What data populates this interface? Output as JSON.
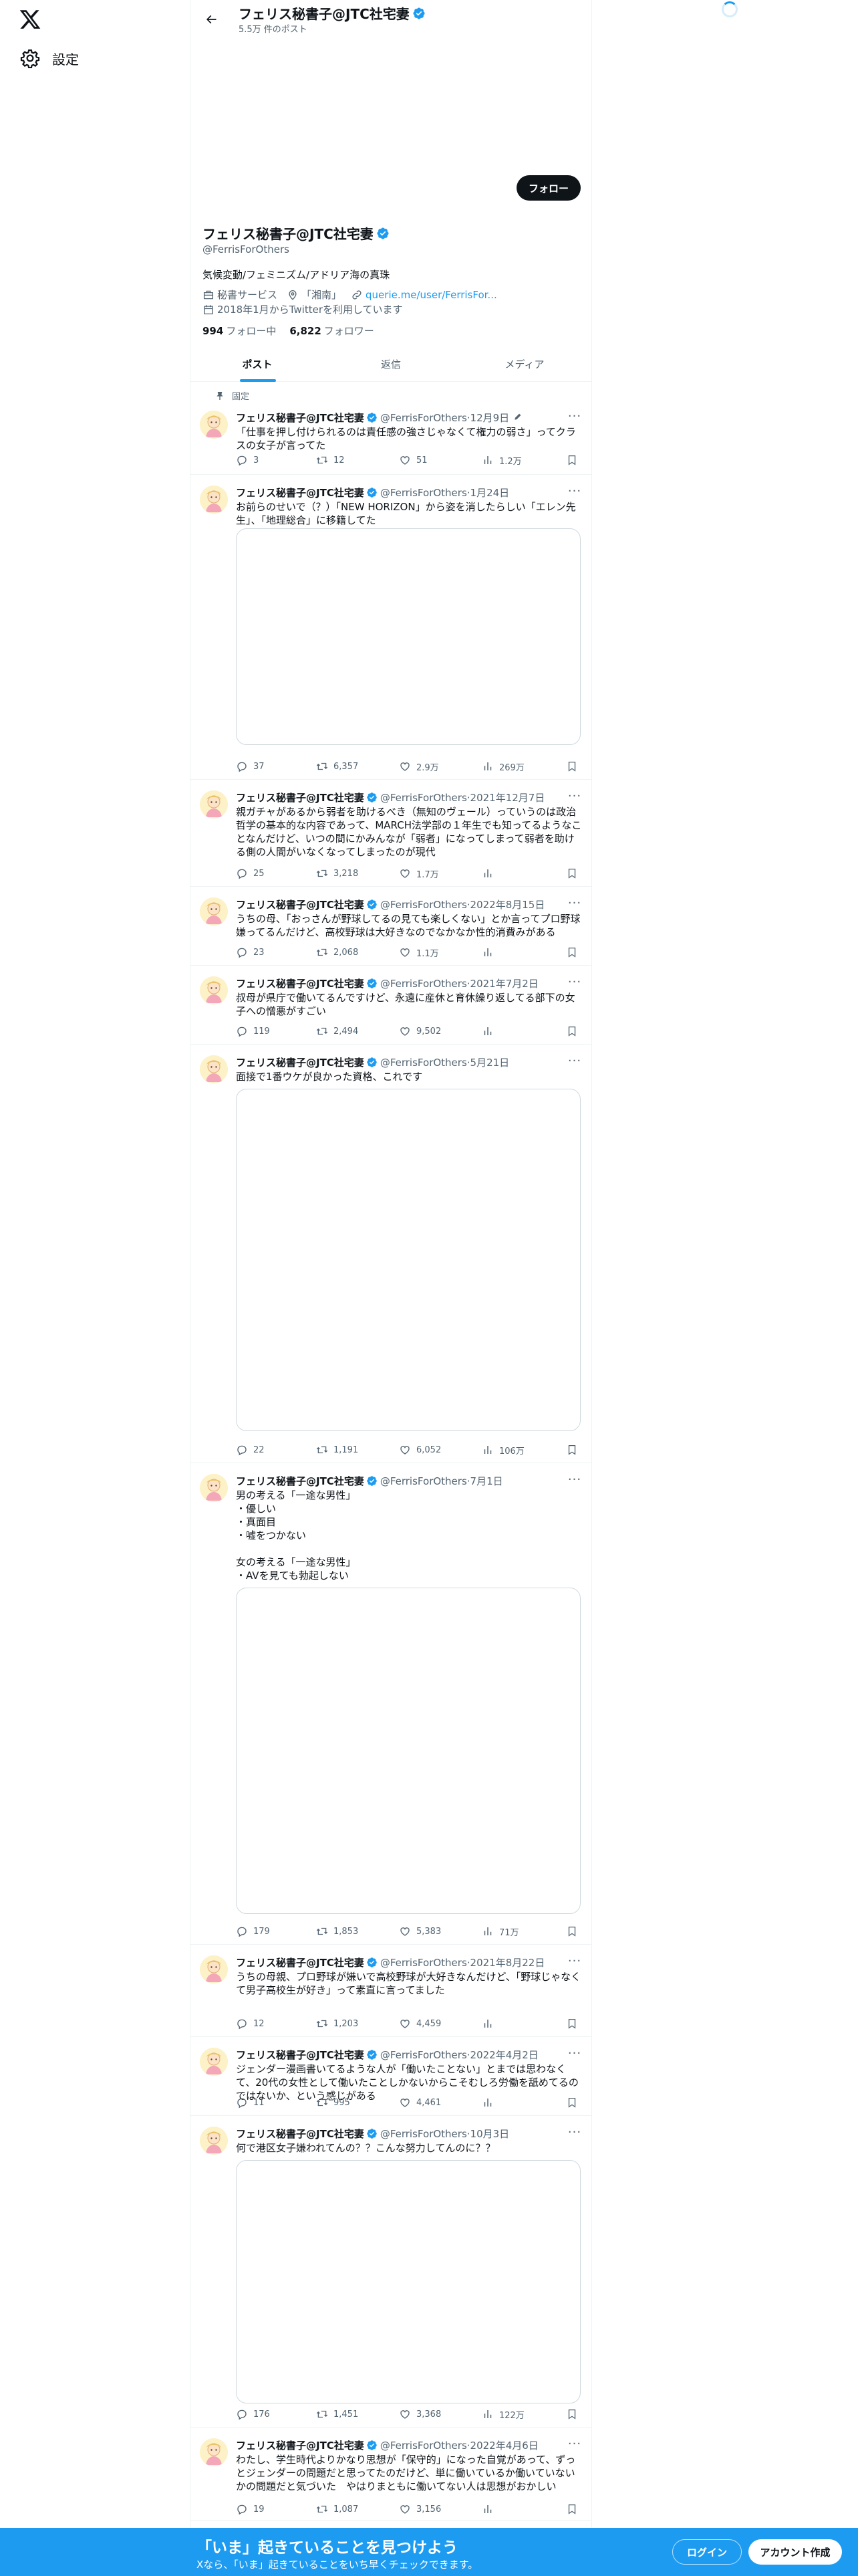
{
  "nav": {
    "settings_label": "設定"
  },
  "header": {
    "name": "フェリス秘書子@JTC社宅妻",
    "post_count": "5.5万 件のポスト"
  },
  "profile": {
    "name": "フェリス秘書子@JTC社宅妻",
    "handle": "@FerrisForOthers",
    "follow_button": "フォロー",
    "bio": "気候変動/フェミニズム/アドリア海の真珠",
    "category": "秘書サービス",
    "location": "「湘南」",
    "link": "querie.me/user/FerrisFor...",
    "joined": "2018年1月からTwitterを利用しています",
    "following_count": "994",
    "following_label": "フォロー中",
    "followers_count": "6,822",
    "followers_label": "フォロワー"
  },
  "tabs": [
    "ポスト",
    "返信",
    "メディア"
  ],
  "pinned_label": "固定",
  "posts": [
    {
      "name": "フェリス秘書子@JTC社宅妻",
      "handle": "@FerrisForOthers",
      "date": "12月9日",
      "text": "「仕事を押し付けられるのは責任感の強さじゃなくて権力の弱さ」ってクラスの女子が言ってた",
      "replies": "3",
      "retweets": "12",
      "likes": "51",
      "views": "1.2万"
    },
    {
      "name": "フェリス秘書子@JTC社宅妻",
      "handle": "@FerrisForOthers",
      "date": "1月24日",
      "text": "お前らのせいで（？）「NEW HORIZON」から姿を消したらしい「エレン先生」、「地理総合」に移籍してた",
      "replies": "37",
      "retweets": "6,357",
      "likes": "2.9万",
      "views": "269万"
    },
    {
      "name": "フェリス秘書子@JTC社宅妻",
      "handle": "@FerrisForOthers",
      "date": "2021年12月7日",
      "text": "親ガチャがあるから弱者を助けるべき（無知のヴェール）っていうのは政治哲学の基本的な内容であって、MARCH法学部の１年生でも知ってるようなことなんだけど、いつの間にかみんなが「弱者」になってしまって弱者を助ける側の人間がいなくなってしまったのが現代",
      "replies": "25",
      "retweets": "3,218",
      "likes": "1.7万",
      "views": ""
    },
    {
      "name": "フェリス秘書子@JTC社宅妻",
      "handle": "@FerrisForOthers",
      "date": "2022年8月15日",
      "text": "うちの母、「おっさんが野球してるの見ても楽しくない」とか言ってプロ野球嫌ってるんだけど、高校野球は大好きなのでなかなか性的消費みがある",
      "replies": "23",
      "retweets": "2,068",
      "likes": "1.1万",
      "views": ""
    },
    {
      "name": "フェリス秘書子@JTC社宅妻",
      "handle": "@FerrisForOthers",
      "date": "2021年7月2日",
      "text": "叔母が県庁で働いてるんですけど、永遠に産休と育休繰り返してる部下の女子への憎悪がすごい",
      "replies": "119",
      "retweets": "2,494",
      "likes": "9,502",
      "views": ""
    },
    {
      "name": "フェリス秘書子@JTC社宅妻",
      "handle": "@FerrisForOthers",
      "date": "5月21日",
      "text": "面接で1番ウケが良かった資格、これです",
      "replies": "22",
      "retweets": "1,191",
      "likes": "6,052",
      "views": "106万"
    },
    {
      "name": "フェリス秘書子@JTC社宅妻",
      "handle": "@FerrisForOthers",
      "date": "7月1日",
      "text": "男の考える「一途な男性」\n・優しい\n・真面目\n・嘘をつかない\n\n女の考える「一途な男性」\n・AVを見ても勃起しない",
      "replies": "179",
      "retweets": "1,853",
      "likes": "5,383",
      "views": "71万"
    },
    {
      "name": "フェリス秘書子@JTC社宅妻",
      "handle": "@FerrisForOthers",
      "date": "2021年8月22日",
      "text": "うちの母親、プロ野球が嫌いで高校野球が大好きなんだけど、「野球じゃなくて男子高校生が好き」って素直に言ってました",
      "replies": "12",
      "retweets": "1,203",
      "likes": "4,459",
      "views": ""
    },
    {
      "name": "フェリス秘書子@JTC社宅妻",
      "handle": "@FerrisForOthers",
      "date": "2022年4月2日",
      "text": "ジェンダー漫画書いてるような人が「働いたことない」とまでは思わなくて、20代の女性として働いたことしかないからこそむしろ労働を舐めてるのではないか、という感じがある",
      "replies": "11",
      "retweets": "995",
      "likes": "4,461",
      "views": ""
    },
    {
      "name": "フェリス秘書子@JTC社宅妻",
      "handle": "@FerrisForOthers",
      "date": "10月3日",
      "text": "何で港区女子嫌われてんの？？こんな努力してんのに？？",
      "replies": "176",
      "retweets": "1,451",
      "likes": "3,368",
      "views": "122万"
    },
    {
      "name": "フェリス秘書子@JTC社宅妻",
      "handle": "@FerrisForOthers",
      "date": "2022年4月6日",
      "text": "わたし、学生時代よりかなり思想が「保守的」になった自覚があって、ずっとジェンダーの問題だと思ってたのだけど、単に働いているか働いていないかの問題だと気づいた　やはりまともに働いてない人は思想がおかしい",
      "replies": "19",
      "retweets": "1,087",
      "likes": "3,156",
      "views": ""
    }
  ],
  "bottom_bar": {
    "title": "「いま」起きていることを見つけよう",
    "subtitle": "Xなら、「いま」起きていることをいち早くチェックできます。",
    "login": "ログイン",
    "signup": "アカウント作成"
  },
  "colors": {
    "accent": "#1d9bf0",
    "text": "#0f1419",
    "muted": "#536471",
    "border": "#eff3f4"
  }
}
